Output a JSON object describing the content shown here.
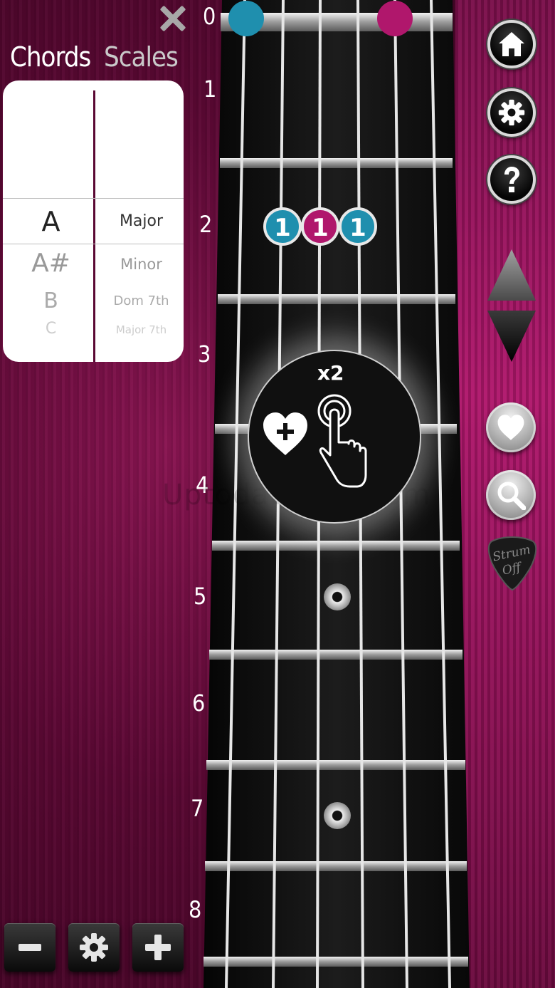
{
  "tabs": {
    "chords": "Chords",
    "scales": "Scales"
  },
  "picker": {
    "notes": [
      "A",
      "A#",
      "B",
      "C"
    ],
    "types": [
      "Major",
      "Minor",
      "Dom 7th",
      "Major 7th"
    ]
  },
  "fret_numbers": [
    "0",
    "1",
    "2",
    "3",
    "4",
    "5",
    "6",
    "7",
    "8"
  ],
  "finger_markers": [
    "1",
    "1",
    "1"
  ],
  "popup": {
    "label": "x2"
  },
  "watermark": "UptodateStar.com",
  "strum_pick": {
    "line1": "Strum",
    "line2": "Off"
  },
  "colors": {
    "teal": "#1f8fae",
    "magenta": "#b0176c",
    "background": "#5a0833"
  },
  "icons": [
    "close-icon",
    "home-icon",
    "gear-icon",
    "question-icon",
    "arrow-up-icon",
    "arrow-down-icon",
    "heart-icon",
    "search-icon",
    "minus-icon",
    "plus-icon",
    "pointer-hand-icon",
    "heart-plus-icon"
  ]
}
